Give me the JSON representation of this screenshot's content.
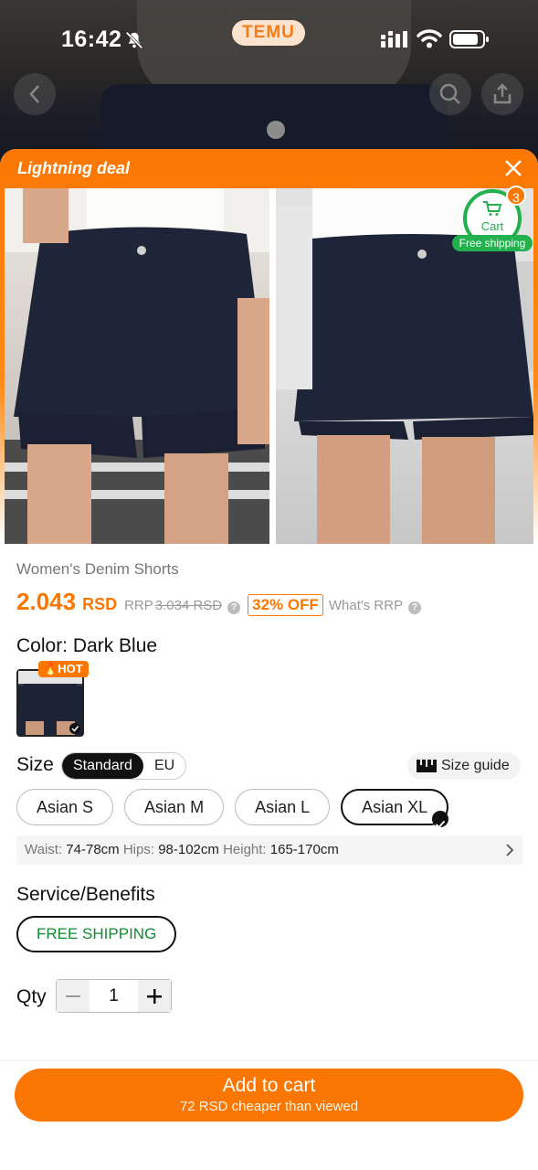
{
  "status": {
    "time": "16:42",
    "app_pill": "TEMU"
  },
  "sheet": {
    "title": "Lightning deal"
  },
  "cart": {
    "label": "Cart",
    "count": "3",
    "free_shipping": "Free shipping"
  },
  "product": {
    "name": "Women's Denim Shorts",
    "price": "2.043",
    "currency": "RSD",
    "rrp_label": "RRP",
    "rrp_value": "3.034 RSD",
    "discount": "32% OFF",
    "whats_rrp": "What's RRP"
  },
  "color": {
    "label": "Color: Dark Blue",
    "hot": "HOT"
  },
  "size": {
    "label": "Size",
    "toggle": [
      "Standard",
      "EU"
    ],
    "guide": "Size guide",
    "options": [
      "Asian S",
      "Asian M",
      "Asian L",
      "Asian XL"
    ],
    "selected": "Asian XL",
    "measure_waist_label": "Waist:",
    "measure_waist": "74-78cm",
    "measure_hips_label": "Hips:",
    "measure_hips": "98-102cm",
    "measure_height_label": "Height:",
    "measure_height": "165-170cm"
  },
  "service": {
    "label": "Service/Benefits",
    "free_shipping": "FREE SHIPPING"
  },
  "qty": {
    "label": "Qty",
    "value": "1"
  },
  "cta": {
    "label": "Add to cart",
    "sub": "72 RSD cheaper than viewed"
  },
  "colors": {
    "accent": "#fb7701",
    "green": "#22b14c"
  }
}
